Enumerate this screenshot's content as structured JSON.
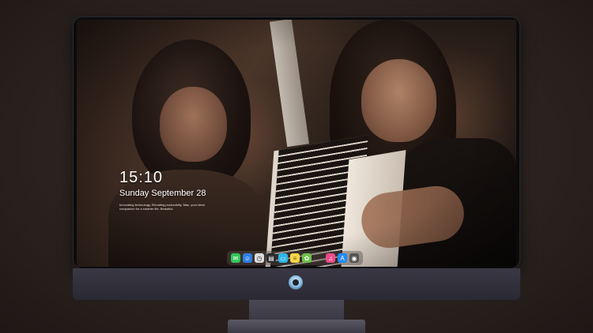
{
  "lockscreen": {
    "time": "15:10",
    "date": "Sunday September 28",
    "slogan": "Innovating technology, Elevating productivity. Mac, your ideal companion for a smarter life. Beautiful."
  },
  "dock": {
    "items": [
      {
        "name": "messages-icon",
        "glyph": "✉",
        "color": "#34c759"
      },
      {
        "name": "finder-icon",
        "glyph": "☺",
        "color": "#2f7fe3"
      },
      {
        "name": "clock-icon",
        "glyph": "◷",
        "color": "#dcdcdc"
      },
      {
        "name": "clapperboard-icon",
        "glyph": "▤",
        "color": "#2a2a2a"
      },
      {
        "name": "tv-icon",
        "glyph": "▭",
        "color": "#2cb5e8"
      },
      {
        "name": "notes-icon",
        "glyph": "≡",
        "color": "#f6d646"
      },
      {
        "name": "photos-icon",
        "glyph": "✿",
        "color": "#6cc04a"
      },
      {
        "name": "music-icon",
        "glyph": "♫",
        "color": "#ef4a8a"
      },
      {
        "name": "app-store-icon",
        "glyph": "A",
        "color": "#1f8bf5"
      },
      {
        "name": "camera-icon",
        "glyph": "◉",
        "color": "#555555"
      }
    ]
  },
  "brand": {
    "logo": "robot-logo-icon"
  }
}
